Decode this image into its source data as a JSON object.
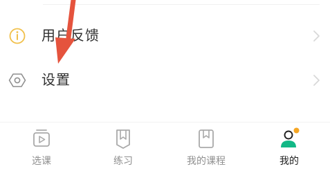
{
  "menu": {
    "items": [
      {
        "label": "用户反馈",
        "icon": "info-icon"
      },
      {
        "label": "设置",
        "icon": "settings-icon"
      }
    ]
  },
  "annotation": {
    "icon": "red-arrow-icon",
    "color": "#e5533d"
  },
  "tabbar": {
    "tabs": [
      {
        "label": "选课",
        "icon": "video-course-icon",
        "active": false
      },
      {
        "label": "练习",
        "icon": "practice-book-icon",
        "active": false
      },
      {
        "label": "我的课程",
        "icon": "my-courses-icon",
        "active": false
      },
      {
        "label": "我的",
        "icon": "profile-icon",
        "active": true
      }
    ]
  },
  "colors": {
    "accent_teal": "#12b886",
    "badge_orange": "#f6a623",
    "info_yellow": "#f1c04a",
    "inactive_gray": "#a9a9a9",
    "chevron_gray": "#d8d8d8"
  }
}
